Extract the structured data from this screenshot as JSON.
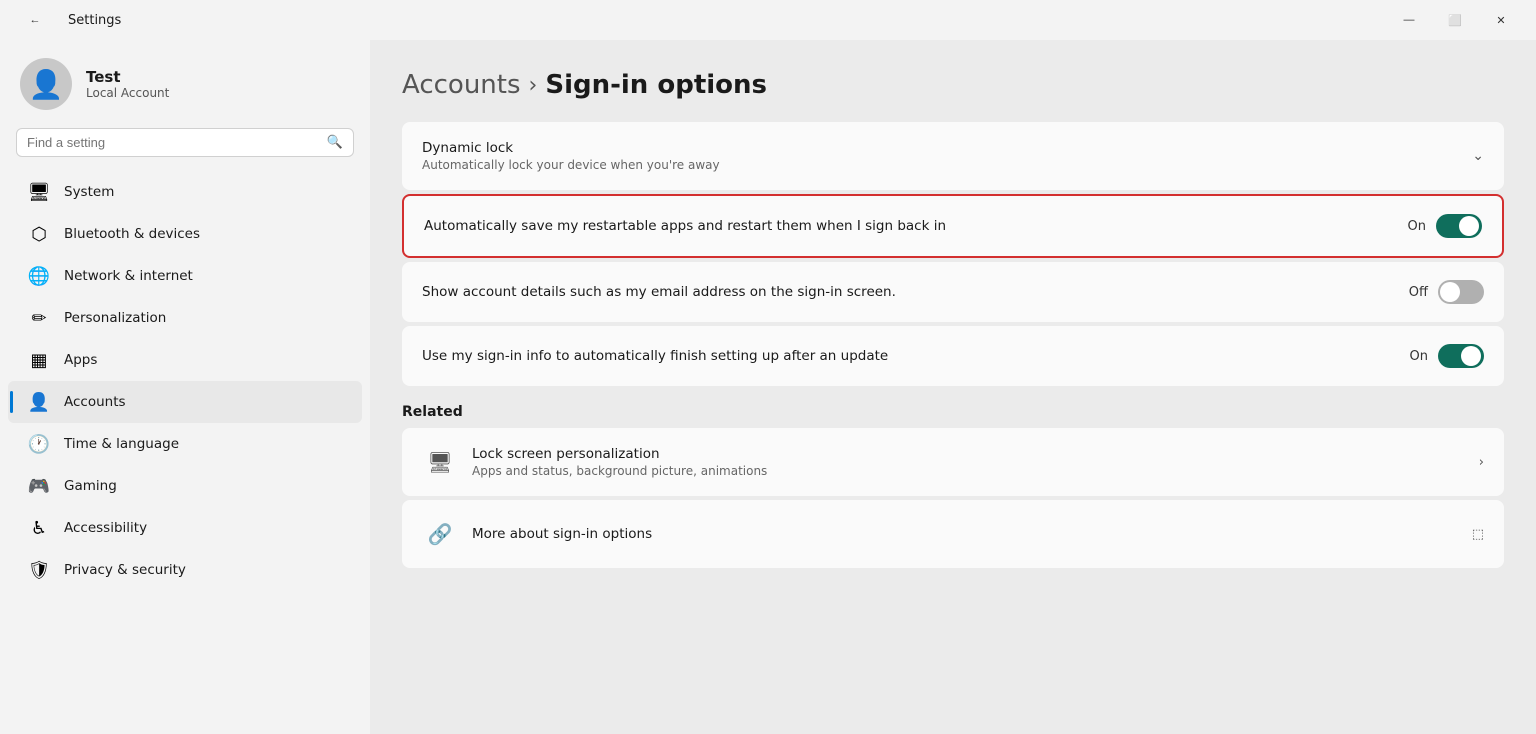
{
  "titleBar": {
    "title": "Settings",
    "backLabel": "←",
    "minimizeLabel": "—",
    "maximizeLabel": "⬜",
    "closeLabel": "✕"
  },
  "sidebar": {
    "user": {
      "name": "Test",
      "accountType": "Local Account"
    },
    "search": {
      "placeholder": "Find a setting"
    },
    "navItems": [
      {
        "id": "system",
        "label": "System",
        "icon": "🖥",
        "active": false
      },
      {
        "id": "bluetooth",
        "label": "Bluetooth & devices",
        "icon": "⬡",
        "active": false
      },
      {
        "id": "network",
        "label": "Network & internet",
        "icon": "🌐",
        "active": false
      },
      {
        "id": "personalization",
        "label": "Personalization",
        "icon": "✏",
        "active": false
      },
      {
        "id": "apps",
        "label": "Apps",
        "icon": "▦",
        "active": false
      },
      {
        "id": "accounts",
        "label": "Accounts",
        "icon": "👤",
        "active": true
      },
      {
        "id": "time",
        "label": "Time & language",
        "icon": "🕐",
        "active": false
      },
      {
        "id": "gaming",
        "label": "Gaming",
        "icon": "🎮",
        "active": false
      },
      {
        "id": "accessibility",
        "label": "Accessibility",
        "icon": "♿",
        "active": false
      },
      {
        "id": "privacy",
        "label": "Privacy & security",
        "icon": "🛡",
        "active": false
      }
    ]
  },
  "content": {
    "breadcrumb": {
      "parent": "Accounts",
      "separator": "›",
      "current": "Sign-in options"
    },
    "settingsGroups": [
      {
        "id": "dynamic-lock",
        "rows": [
          {
            "id": "dynamic-lock-row",
            "title": "Dynamic lock",
            "subtitle": "Automatically lock your device when you're away",
            "controlType": "chevron",
            "highlighted": false
          }
        ]
      },
      {
        "id": "restart-apps",
        "highlighted": true,
        "rows": [
          {
            "id": "restart-apps-row",
            "title": "Automatically save my restartable apps and restart them when I sign back in",
            "subtitle": "",
            "controlType": "toggle",
            "toggleState": "on",
            "toggleLabel": "On"
          }
        ]
      },
      {
        "id": "account-details",
        "rows": [
          {
            "id": "account-details-row",
            "title": "Show account details such as my email address on the sign-in screen.",
            "subtitle": "",
            "controlType": "toggle",
            "toggleState": "off",
            "toggleLabel": "Off"
          }
        ]
      },
      {
        "id": "sign-in-info",
        "rows": [
          {
            "id": "sign-in-info-row",
            "title": "Use my sign-in info to automatically finish setting up after an update",
            "subtitle": "",
            "controlType": "toggle",
            "toggleState": "on",
            "toggleLabel": "On"
          }
        ]
      }
    ],
    "related": {
      "title": "Related",
      "items": [
        {
          "id": "lock-screen",
          "title": "Lock screen personalization",
          "subtitle": "Apps and status, background picture, animations",
          "controlType": "chevron"
        },
        {
          "id": "more-sign-in",
          "title": "More about sign-in options",
          "subtitle": "",
          "controlType": "external"
        }
      ]
    }
  }
}
